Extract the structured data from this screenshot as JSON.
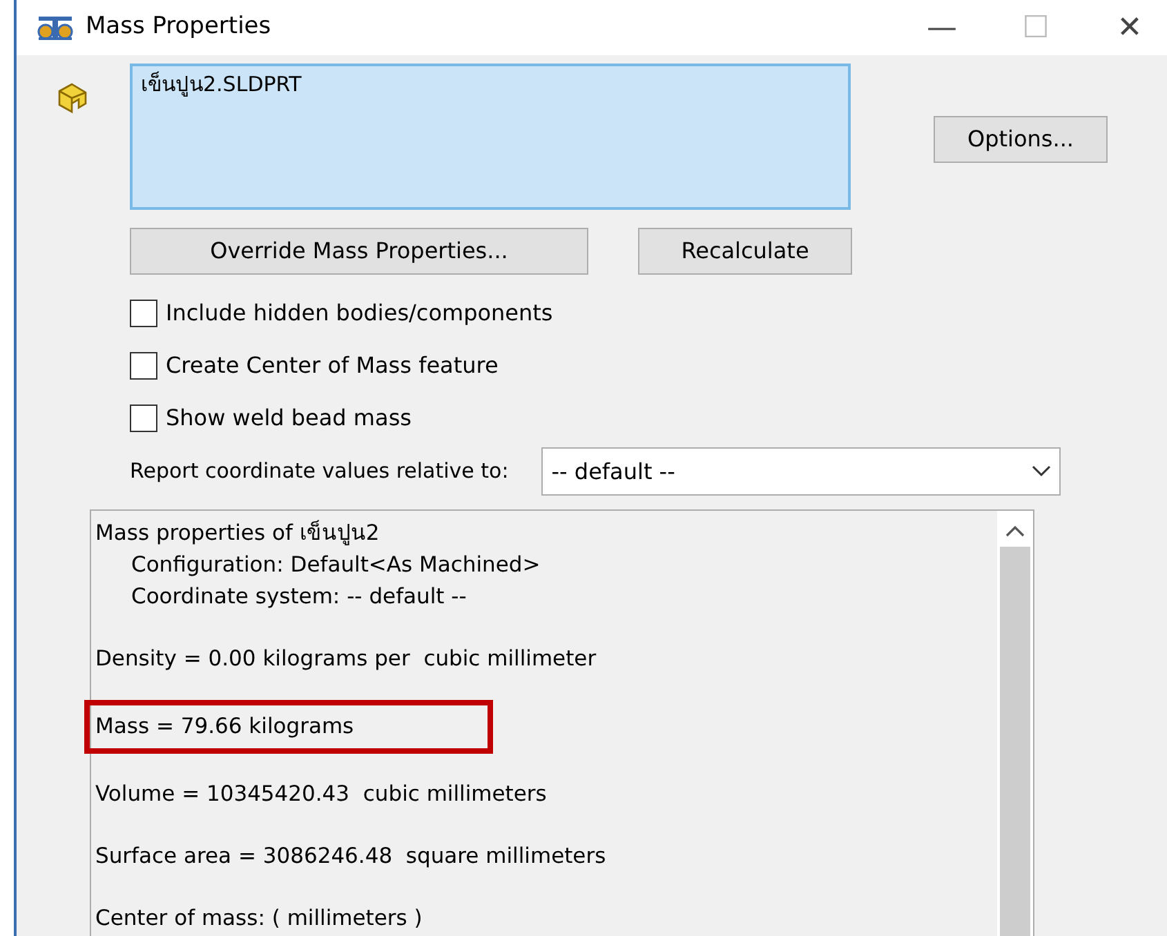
{
  "window": {
    "title": "Mass Properties",
    "controls": [
      "—",
      "☐",
      "✕"
    ]
  },
  "file_list": {
    "items": [
      {
        "label": "เข็นปูน2.SLDPRT",
        "selected": false
      }
    ]
  },
  "buttons": {
    "options": "Options...",
    "override": "Override Mass Properties...",
    "recalculate": "Recalculate"
  },
  "checkboxes": [
    {
      "label": "Include hidden bodies/components",
      "checked": false
    },
    {
      "label": "Create Center of Mass feature",
      "checked": false
    },
    {
      "label": "Show weld bead mass",
      "checked": false
    }
  ],
  "coordinate": {
    "label": "Report coordinate values relative to:",
    "value": "-- default --"
  },
  "results": [
    {
      "kind": "heading",
      "text": "Mass properties of เข็นปูน2",
      "highlighted": false
    },
    {
      "kind": "detail",
      "text": "Configuration: Default<As Machined>",
      "highlighted": false
    },
    {
      "kind": "detail",
      "text": "Coordinate system: -- default --",
      "highlighted": false
    },
    {
      "kind": "result",
      "text": "Density = 0.00 kilograms per  cubic millimeter",
      "highlighted": false
    },
    {
      "kind": "result",
      "text": "Mass = 79.66 kilograms",
      "highlighted": true
    },
    {
      "kind": "result",
      "text": "Volume = 10345420.43  cubic millimeters",
      "highlighted": false
    },
    {
      "kind": "result",
      "text": "Surface area = 3086246.48  square millimeters",
      "highlighted": false
    },
    {
      "kind": "result",
      "text": "Center of mass: ( millimeters )",
      "highlighted": false
    }
  ]
}
